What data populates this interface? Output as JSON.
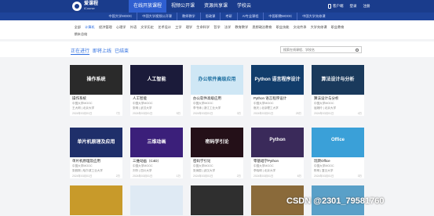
{
  "header": {
    "logo_cn": "爱课程",
    "logo_en": "iCourse",
    "nav": [
      "在线开放课程",
      "视频公开课",
      "资源共享课",
      "学校云"
    ],
    "app_label": "客户端",
    "login": "登录",
    "register": "注册"
  },
  "subnav": [
    "中国大学MOOC",
    "中国大学视频公开课",
    "教师教学",
    "思政课",
    "考研",
    "AI专业课程",
    "中国职教MOOC",
    "中国大学先修课"
  ],
  "filters": {
    "row1": [
      "全部",
      "计算机",
      "经济管理",
      "心理学",
      "外语",
      "文学历史",
      "艺术设计",
      "工学",
      "理学",
      "生命科学",
      "哲学",
      "法学",
      "教育教学",
      "思想政治教育",
      "职业技能",
      "文化传承",
      "大学先修课",
      "职业教育"
    ],
    "row1_selected": "计算机",
    "row2": [
      "期末总结"
    ]
  },
  "tabs": {
    "items": [
      "正在进行",
      "即将上线",
      "已结束"
    ],
    "selected": "正在进行"
  },
  "search": {
    "placeholder": "搜索在线课程、学校名"
  },
  "courses": [
    {
      "title": "操作系统",
      "school": "中国大学MOOC",
      "teacher": "王大明 | 北京大学",
      "date": "2024年03月01日",
      "count": "7万",
      "thumb_text": "操作系统",
      "bg": "#2a2a2a"
    },
    {
      "title": "人工智能",
      "school": "中国大学MOOC",
      "teacher": "张明 | 武汉大学",
      "date": "2024年03月01日",
      "count": "5万",
      "thumb_text": "人工智能",
      "bg": "#1b1b3a"
    },
    {
      "title": "办公软件高级应用",
      "school": "中国大学MOOC",
      "teacher": "李书涛 | 浙江工业大学",
      "date": "2024年03月01日",
      "count": "3万",
      "thumb_text": "办公软件高级应用",
      "bg": "#cfe7f5"
    },
    {
      "title": "Python 语言程序设计",
      "school": "中国大学MOOC",
      "teacher": "嵩天 | 北京理工大学",
      "date": "2024年03月01日",
      "count": "25万",
      "thumb_text": "Python 语言程序设计",
      "bg": "#123d6b"
    },
    {
      "title": "算法设计与分析",
      "school": "中国大学MOOC",
      "teacher": "屈婉玲 | 北京大学",
      "date": "2024年03月01日",
      "count": "4万",
      "thumb_text": "算法设计与分析",
      "bg": "#1a3a5c"
    },
    {
      "title": "单片机原理及应用",
      "school": "中国大学MOOC",
      "teacher": "张毅刚 | 哈尔滨工业大学",
      "date": "2024年03月01日",
      "count": "2万",
      "thumb_text": "单片机原理及应用",
      "bg": "#1f2f6a"
    },
    {
      "title": "三维动画（C4D）",
      "school": "中国大学MOOC",
      "teacher": "刘华 | 四川大学",
      "date": "2024年03月01日",
      "count": "1万",
      "thumb_text": "三维动画",
      "bg": "#3b1f7a"
    },
    {
      "title": "密码学引论",
      "school": "中国大学MOOC",
      "teacher": "张焕国 | 武汉大学",
      "date": "2024年03月01日",
      "count": "2万",
      "thumb_text": "密码学引论",
      "bg": "#241018"
    },
    {
      "title": "零基础学Python",
      "school": "中国大学MOOC",
      "teacher": "李晓明 | 北京大学",
      "date": "2024年03月01日",
      "count": "6万",
      "thumb_text": "Python",
      "bg": "#3a2a5a"
    },
    {
      "title": "玩转Office",
      "school": "中国大学MOOC",
      "teacher": "陈明 | 复旦大学",
      "date": "2024年03月01日",
      "count": "3万",
      "thumb_text": "Office",
      "bg": "#3aa0d8"
    }
  ],
  "row3_thumbs": [
    {
      "thumb_text": "",
      "bg": "#c89a2a"
    },
    {
      "thumb_text": "",
      "bg": "#dfeaf4"
    },
    {
      "thumb_text": "",
      "bg": "#2f2f2f"
    },
    {
      "thumb_text": "",
      "bg": "#8a6a3a"
    },
    {
      "thumb_text": "",
      "bg": "#5aa0c8"
    }
  ],
  "watermark": "CSDN @2301_79581760"
}
